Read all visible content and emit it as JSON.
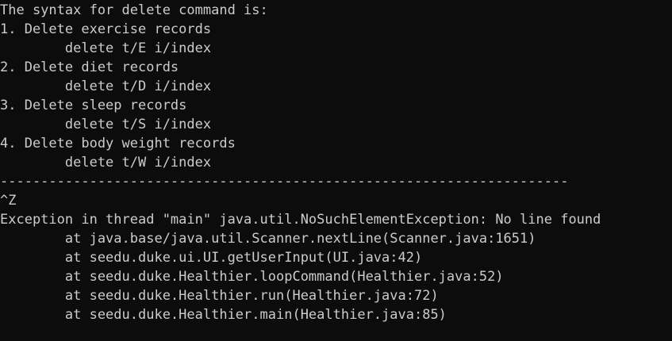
{
  "terminal": {
    "background": "#0c0c0c",
    "foreground": "#cccccc",
    "lines": [
      "The syntax for delete command is:",
      "1. Delete exercise records",
      "        delete t/E i/index",
      "2. Delete diet records",
      "        delete t/D i/index",
      "3. Delete sleep records",
      "        delete t/S i/index",
      "4. Delete body weight records",
      "        delete t/W i/index",
      "----------------------------------------------------------------------",
      "^Z",
      "Exception in thread \"main\" java.util.NoSuchElementException: No line found",
      "        at java.base/java.util.Scanner.nextLine(Scanner.java:1651)",
      "        at seedu.duke.ui.UI.getUserInput(UI.java:42)",
      "        at seedu.duke.Healthier.loopCommand(Healthier.java:52)",
      "        at seedu.duke.Healthier.run(Healthier.java:72)",
      "        at seedu.duke.Healthier.main(Healthier.java:85)"
    ]
  }
}
